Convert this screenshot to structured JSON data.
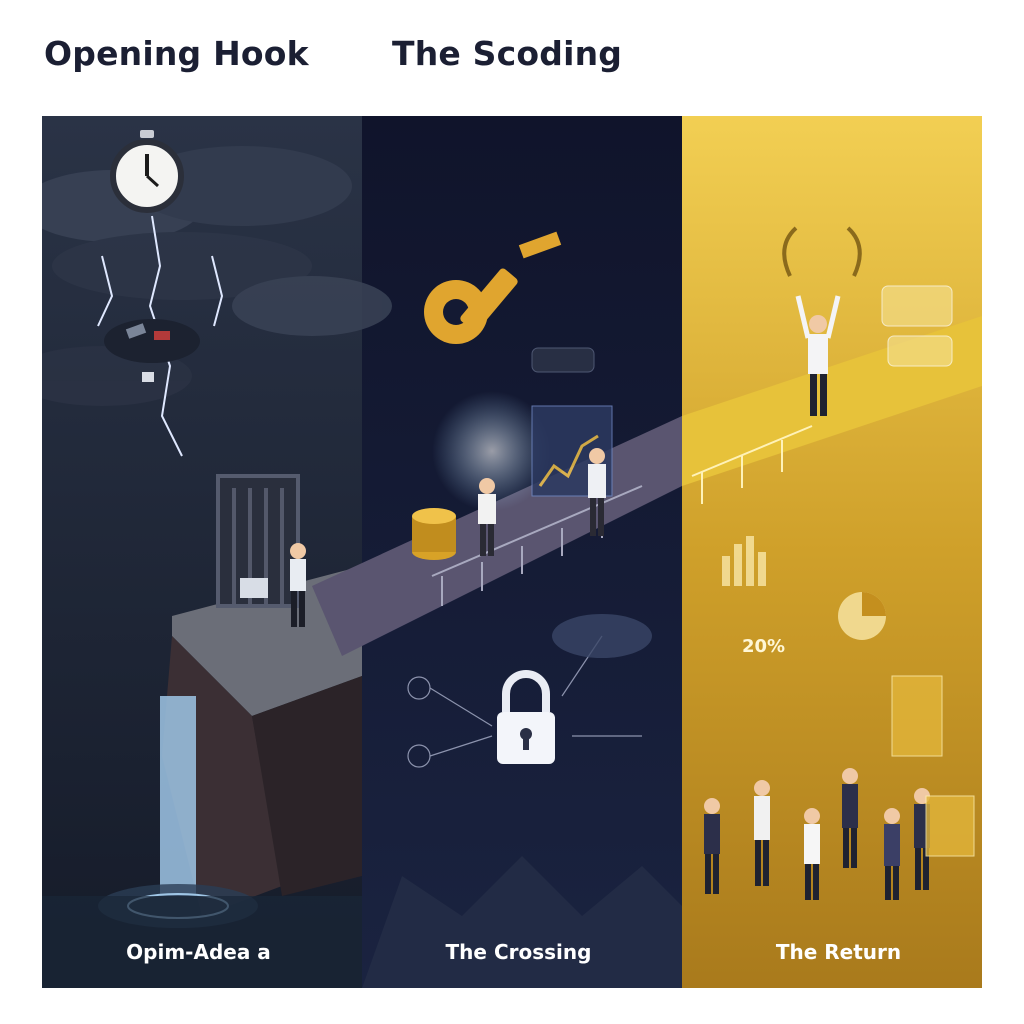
{
  "headings": {
    "left": "Opening Hook",
    "middle": "The Scoding"
  },
  "panels": [
    {
      "caption": "Opim-Adea a"
    },
    {
      "caption": "The Crossing"
    },
    {
      "caption": "The Return"
    }
  ],
  "stat_badge": "20%",
  "icons": [
    "clock-icon",
    "lightning-icon",
    "gate-icon",
    "key-icon",
    "padlock-icon",
    "laurel-wreath-icon",
    "coins-icon",
    "bar-chart-icon",
    "pie-chart-icon"
  ],
  "colors": {
    "heading": "#1b1f33",
    "panel_left": "#1d2436",
    "panel_middle": "#141a33",
    "panel_right": "#d4a62a",
    "path": "#e7c23a"
  }
}
